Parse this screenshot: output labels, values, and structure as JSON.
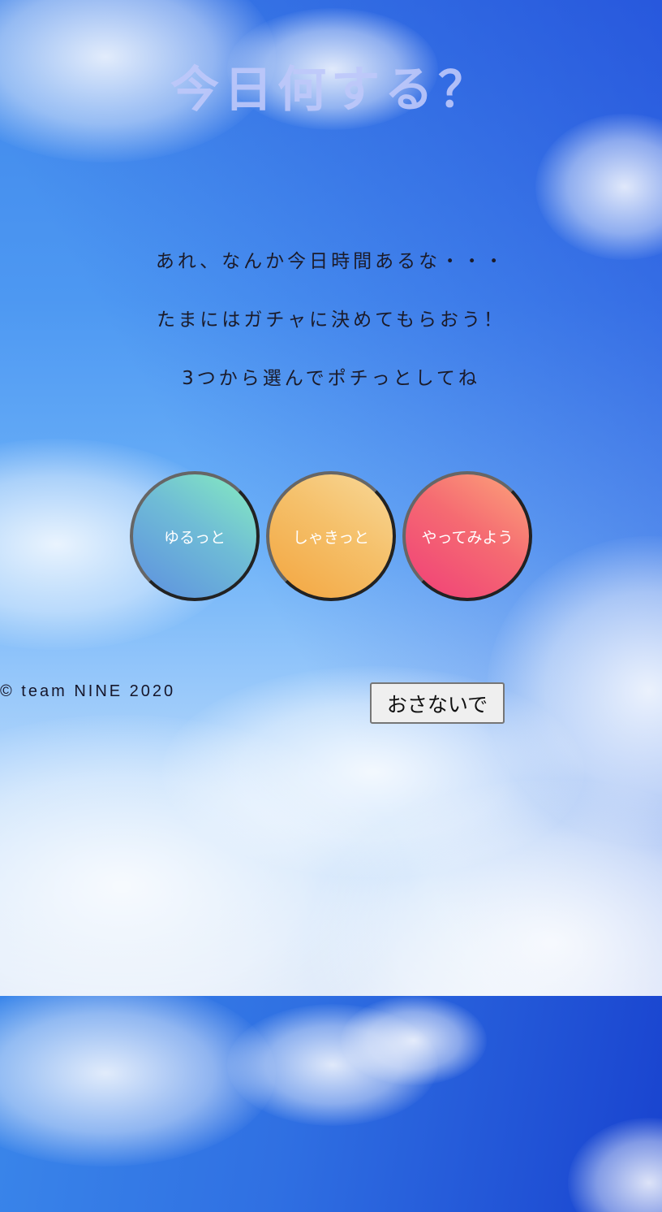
{
  "page": {
    "title": "今日何する？",
    "messages": [
      "あれ、なんか今日時間あるな・・・",
      "たまにはガチャに決めてもらおう！",
      "3つから選んでポチっとしてね"
    ]
  },
  "choices": [
    {
      "label": "ゆるっと",
      "gradient_colors": [
        "#5d8fe0",
        "#86edbf"
      ]
    },
    {
      "label": "しゃきっと",
      "gradient_colors": [
        "#f3a53f",
        "#f8d898"
      ]
    },
    {
      "label": "やってみよう",
      "gradient_colors": [
        "#f03e78",
        "#fca57a"
      ]
    }
  ],
  "footer": {
    "copyright": "©  team NINE  2020",
    "button_label": "おさないで"
  },
  "colors": {
    "sky": "#4d98f2",
    "title_text": "#bec8fa",
    "body_text": "#1b1b2a"
  }
}
